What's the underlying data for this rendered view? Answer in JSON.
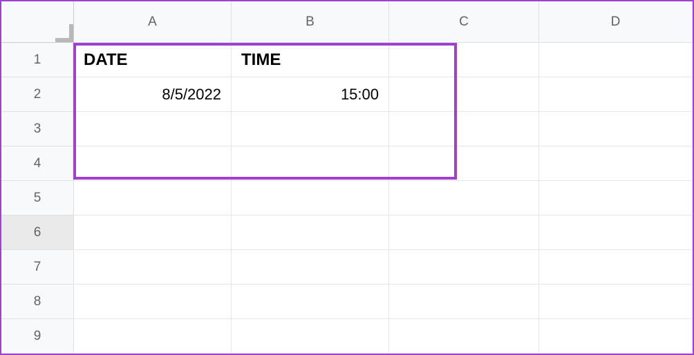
{
  "columns": [
    "A",
    "B",
    "C",
    "D"
  ],
  "rows": [
    "1",
    "2",
    "3",
    "4",
    "5",
    "6",
    "7",
    "8",
    "9"
  ],
  "cells": {
    "A1": "DATE",
    "B1": "TIME",
    "A2": "8/5/2022",
    "B2": "15:00"
  },
  "selected_row_header": "6",
  "chart_data": {
    "type": "table",
    "columns": [
      "DATE",
      "TIME"
    ],
    "rows": [
      {
        "DATE": "8/5/2022",
        "TIME": "15:00"
      }
    ]
  }
}
